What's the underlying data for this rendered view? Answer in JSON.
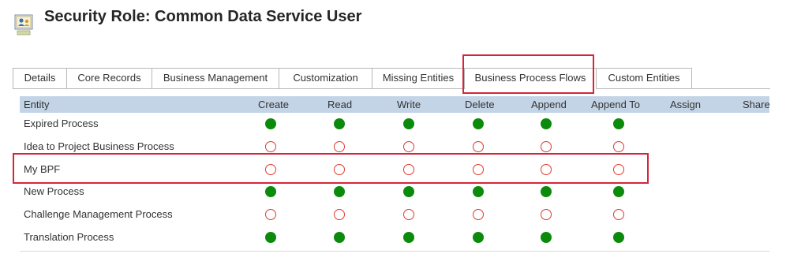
{
  "title": "Security Role: Common Data Service User",
  "tabs": [
    {
      "label": "Details"
    },
    {
      "label": "Core Records"
    },
    {
      "label": "Business Management"
    },
    {
      "label": "Customization"
    },
    {
      "label": "Missing Entities"
    },
    {
      "label": "Business Process Flows"
    },
    {
      "label": "Custom Entities"
    }
  ],
  "active_tab": "Business Process Flows",
  "columns": [
    "Entity",
    "Create",
    "Read",
    "Write",
    "Delete",
    "Append",
    "Append To",
    "Assign",
    "Share"
  ],
  "rows": [
    {
      "entity": "Expired Process",
      "privileges": [
        "full",
        "full",
        "full",
        "full",
        "full",
        "full"
      ]
    },
    {
      "entity": "Idea to Project Business Process",
      "privileges": [
        "none",
        "none",
        "none",
        "none",
        "none",
        "none"
      ]
    },
    {
      "entity": "My BPF",
      "privileges": [
        "none",
        "none",
        "none",
        "none",
        "none",
        "none"
      ]
    },
    {
      "entity": "New Process",
      "privileges": [
        "full",
        "full",
        "full",
        "full",
        "full",
        "full"
      ]
    },
    {
      "entity": "Challenge Management Process",
      "privileges": [
        "none",
        "none",
        "none",
        "none",
        "none",
        "none"
      ]
    },
    {
      "entity": "Translation Process",
      "privileges": [
        "full",
        "full",
        "full",
        "full",
        "full",
        "full"
      ]
    }
  ],
  "colors": {
    "full": "#0b8a0b",
    "none": "#e0392f",
    "highlight": "#d6243a",
    "header_bg": "#c3d4e6"
  },
  "icons": {
    "role": "security-role-icon",
    "full": "filled-green-circle",
    "none": "hollow-red-circle"
  }
}
